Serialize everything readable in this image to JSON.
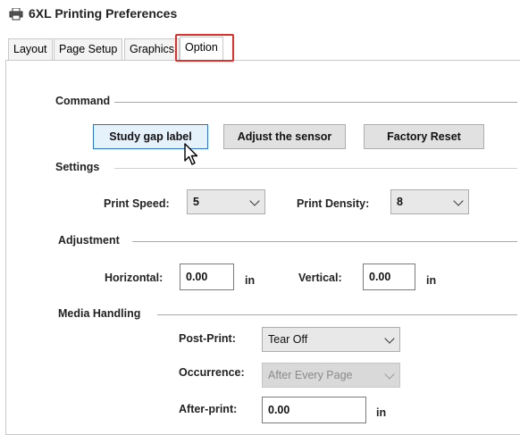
{
  "window": {
    "title": "6XL Printing Preferences",
    "icon": "printer-icon"
  },
  "tabs": [
    {
      "label": "Layout"
    },
    {
      "label": "Page Setup"
    },
    {
      "label": "Graphics"
    },
    {
      "label": "Option",
      "active": true
    }
  ],
  "command": {
    "header": "Command",
    "buttons": [
      {
        "label": "Study gap label"
      },
      {
        "label": "Adjust the sensor"
      },
      {
        "label": "Factory Reset"
      }
    ]
  },
  "settings": {
    "header": "Settings",
    "print_speed": {
      "label": "Print Speed:",
      "value": "5"
    },
    "print_density": {
      "label": "Print Density:",
      "value": "8"
    }
  },
  "adjustment": {
    "header": "Adjustment",
    "horizontal": {
      "label": "Horizontal:",
      "value": "0.00",
      "unit": "in"
    },
    "vertical": {
      "label": "Vertical:",
      "value": "0.00",
      "unit": "in"
    }
  },
  "media_handling": {
    "header": "Media Handling",
    "post_print": {
      "label": "Post-Print:",
      "value": "Tear Off"
    },
    "occurrence": {
      "label": "Occurrence:",
      "value": "After Every Page",
      "disabled": true
    },
    "after_print": {
      "label": "After-print:",
      "value": "0.00",
      "unit": "in"
    }
  },
  "colors": {
    "highlight": "#e0302c",
    "focus": "#2b74c7"
  }
}
